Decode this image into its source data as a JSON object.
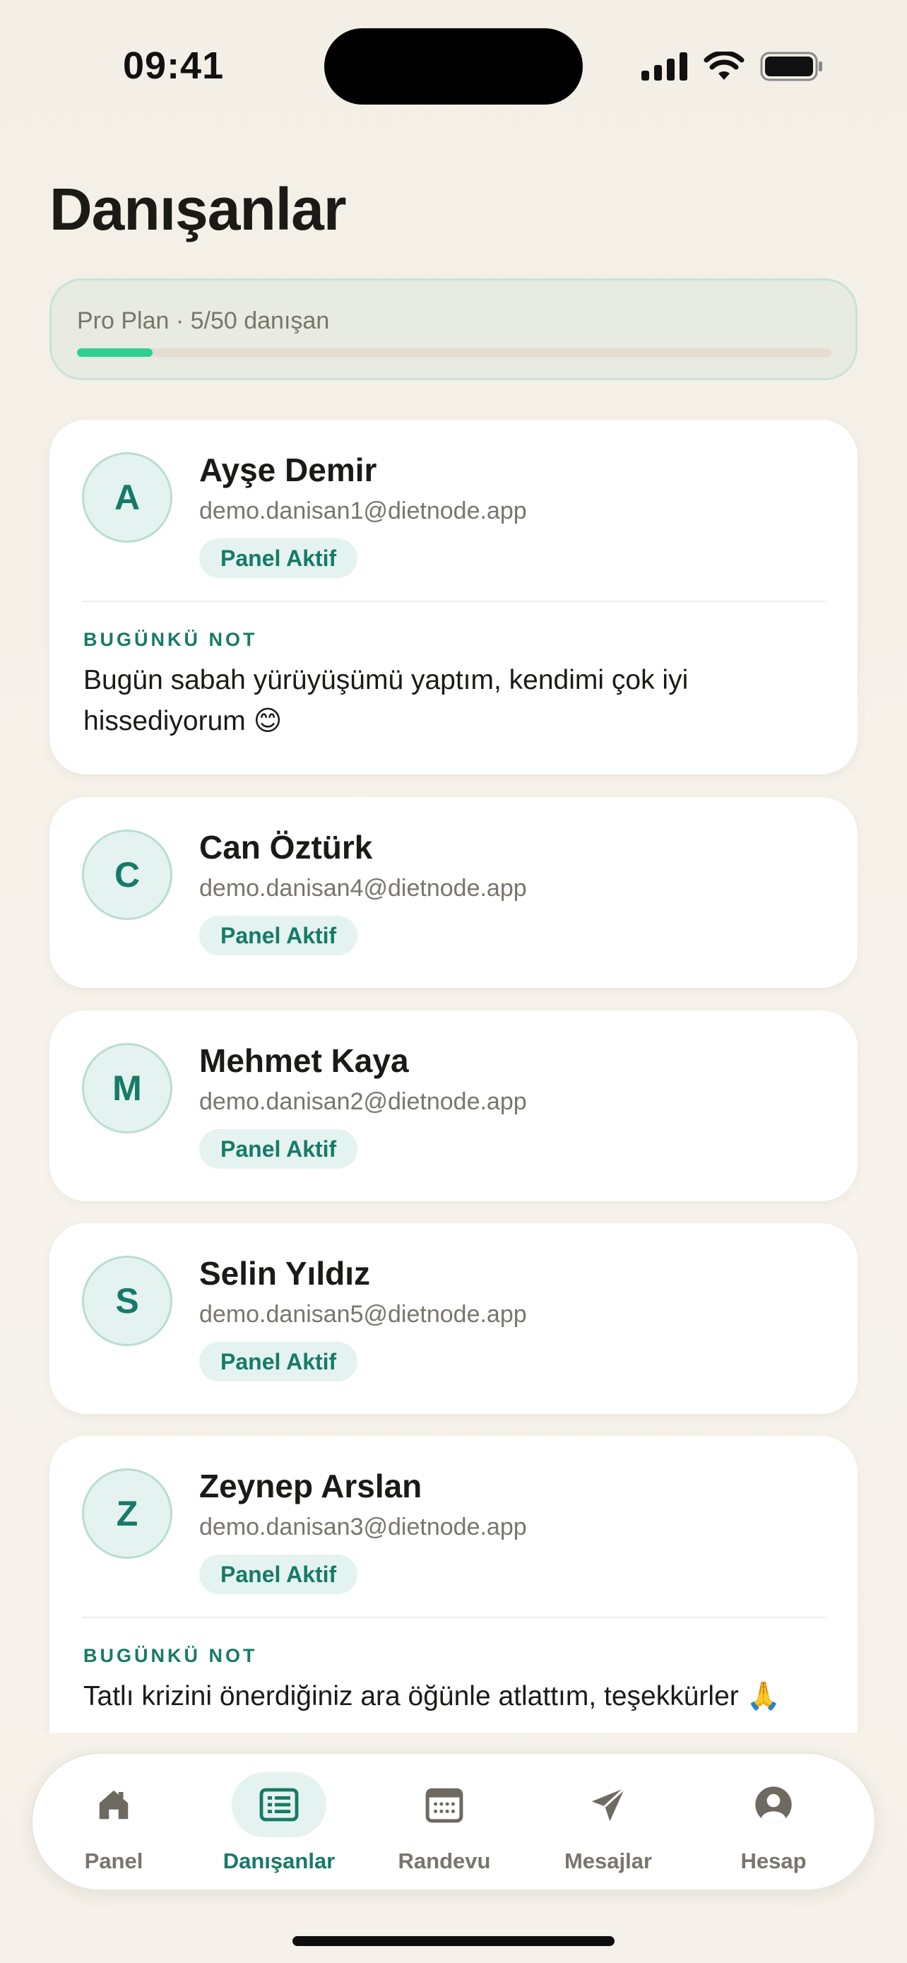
{
  "status_bar": {
    "time": "09:41"
  },
  "page": {
    "title": "Danışanlar"
  },
  "plan": {
    "label": "Pro Plan · 5/50 danışan",
    "progress_fraction": 0.1
  },
  "note_label": "BUGÜNKÜ NOT",
  "clients": [
    {
      "initial": "A",
      "name": "Ayşe Demir",
      "email": "demo.danisan1@dietnode.app",
      "status": "Panel Aktif",
      "note": "Bugün sabah yürüyüşümü yaptım, kendimi çok iyi hissediyorum 😊"
    },
    {
      "initial": "C",
      "name": "Can Öztürk",
      "email": "demo.danisan4@dietnode.app",
      "status": "Panel Aktif"
    },
    {
      "initial": "M",
      "name": "Mehmet Kaya",
      "email": "demo.danisan2@dietnode.app",
      "status": "Panel Aktif"
    },
    {
      "initial": "S",
      "name": "Selin Yıldız",
      "email": "demo.danisan5@dietnode.app",
      "status": "Panel Aktif"
    },
    {
      "initial": "Z",
      "name": "Zeynep Arslan",
      "email": "demo.danisan3@dietnode.app",
      "status": "Panel Aktif",
      "note": "Tatlı krizini önerdiğiniz ara öğünle atlattım, teşekkürler 🙏"
    }
  ],
  "tabs": [
    {
      "label": "Panel",
      "icon": "home-icon",
      "active": false
    },
    {
      "label": "Danışanlar",
      "icon": "client-list-icon",
      "active": true
    },
    {
      "label": "Randevu",
      "icon": "calendar-icon",
      "active": false
    },
    {
      "label": "Mesajlar",
      "icon": "send-icon",
      "active": false
    },
    {
      "label": "Hesap",
      "icon": "account-icon",
      "active": false
    }
  ],
  "colors": {
    "accent": "#177a68",
    "progress": "#2fcf94",
    "badge_bg": "#e4f3ef"
  }
}
